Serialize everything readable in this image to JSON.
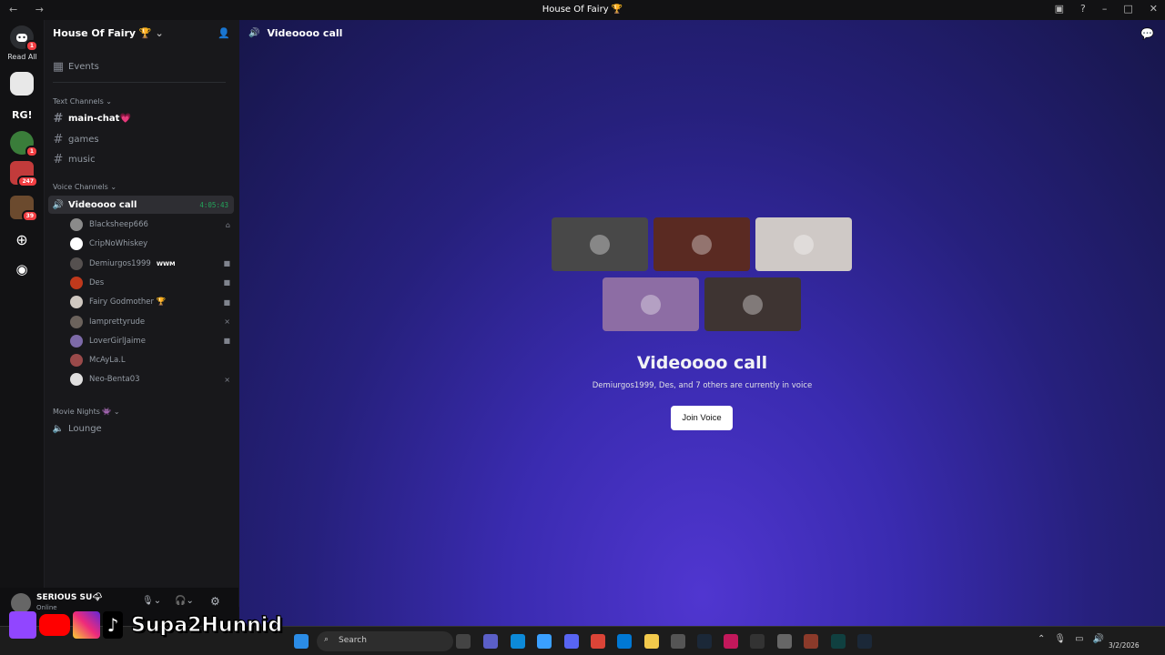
{
  "window": {
    "title": "House Of Fairy 🏆"
  },
  "rail": {
    "read_all": "Read All",
    "badges": {
      "dm": "1",
      "s3": "1",
      "s4": "247",
      "s5": "39"
    }
  },
  "server": {
    "name": "House Of Fairy 🏆"
  },
  "sidebar": {
    "events": "Events",
    "text_category": "Text Channels",
    "text_channels": [
      "main-chat💗",
      "games",
      "music"
    ],
    "voice_category": "Voice Channels",
    "active_voice": {
      "name": "Videoooo call",
      "timer": "4:05:43"
    },
    "members": [
      {
        "name": "Blacksheep666",
        "color": "#8a8a8a",
        "icon": "playstation-icon"
      },
      {
        "name": "CripNoWhiskey",
        "color": "#ffffff",
        "icon": ""
      },
      {
        "name": "Demiurgos1999",
        "color": "#55504f",
        "icon": "video-icon",
        "tag": "WWM"
      },
      {
        "name": "Des",
        "color": "#c0391c",
        "icon": "video-icon"
      },
      {
        "name": "Fairy Godmother 🏆",
        "color": "#cfc7c0",
        "icon": "video-icon"
      },
      {
        "name": "Iamprettyrude",
        "color": "#6b625c",
        "icon": "mic-muted-icon"
      },
      {
        "name": "LoverGirlJaime",
        "color": "#7d6aa8",
        "icon": "video-icon"
      },
      {
        "name": "McAyLa.L",
        "color": "#9a4a4a",
        "icon": ""
      },
      {
        "name": "Neo-Benta03",
        "color": "#e0dfdf",
        "icon": "mic-muted-icon"
      }
    ],
    "movie_category": "Movie Nights 👾",
    "lounge": "Lounge"
  },
  "user": {
    "name": "SERIOUS SU🌩",
    "status": "Online"
  },
  "main": {
    "header": "Videoooo call",
    "vc_title": "Videoooo call",
    "vc_subtitle": "Demiurgos1999, Des, and 7 others are currently in voice",
    "join_label": "Join Voice",
    "tiles": [
      "#484848",
      "#5a2a22",
      "#cfc9c6",
      "#8d6da4",
      "#3e3432"
    ]
  },
  "overlay": {
    "brand": "Supa2Hunnid"
  },
  "taskbar": {
    "search": "Search",
    "date": "3/2/2026"
  }
}
